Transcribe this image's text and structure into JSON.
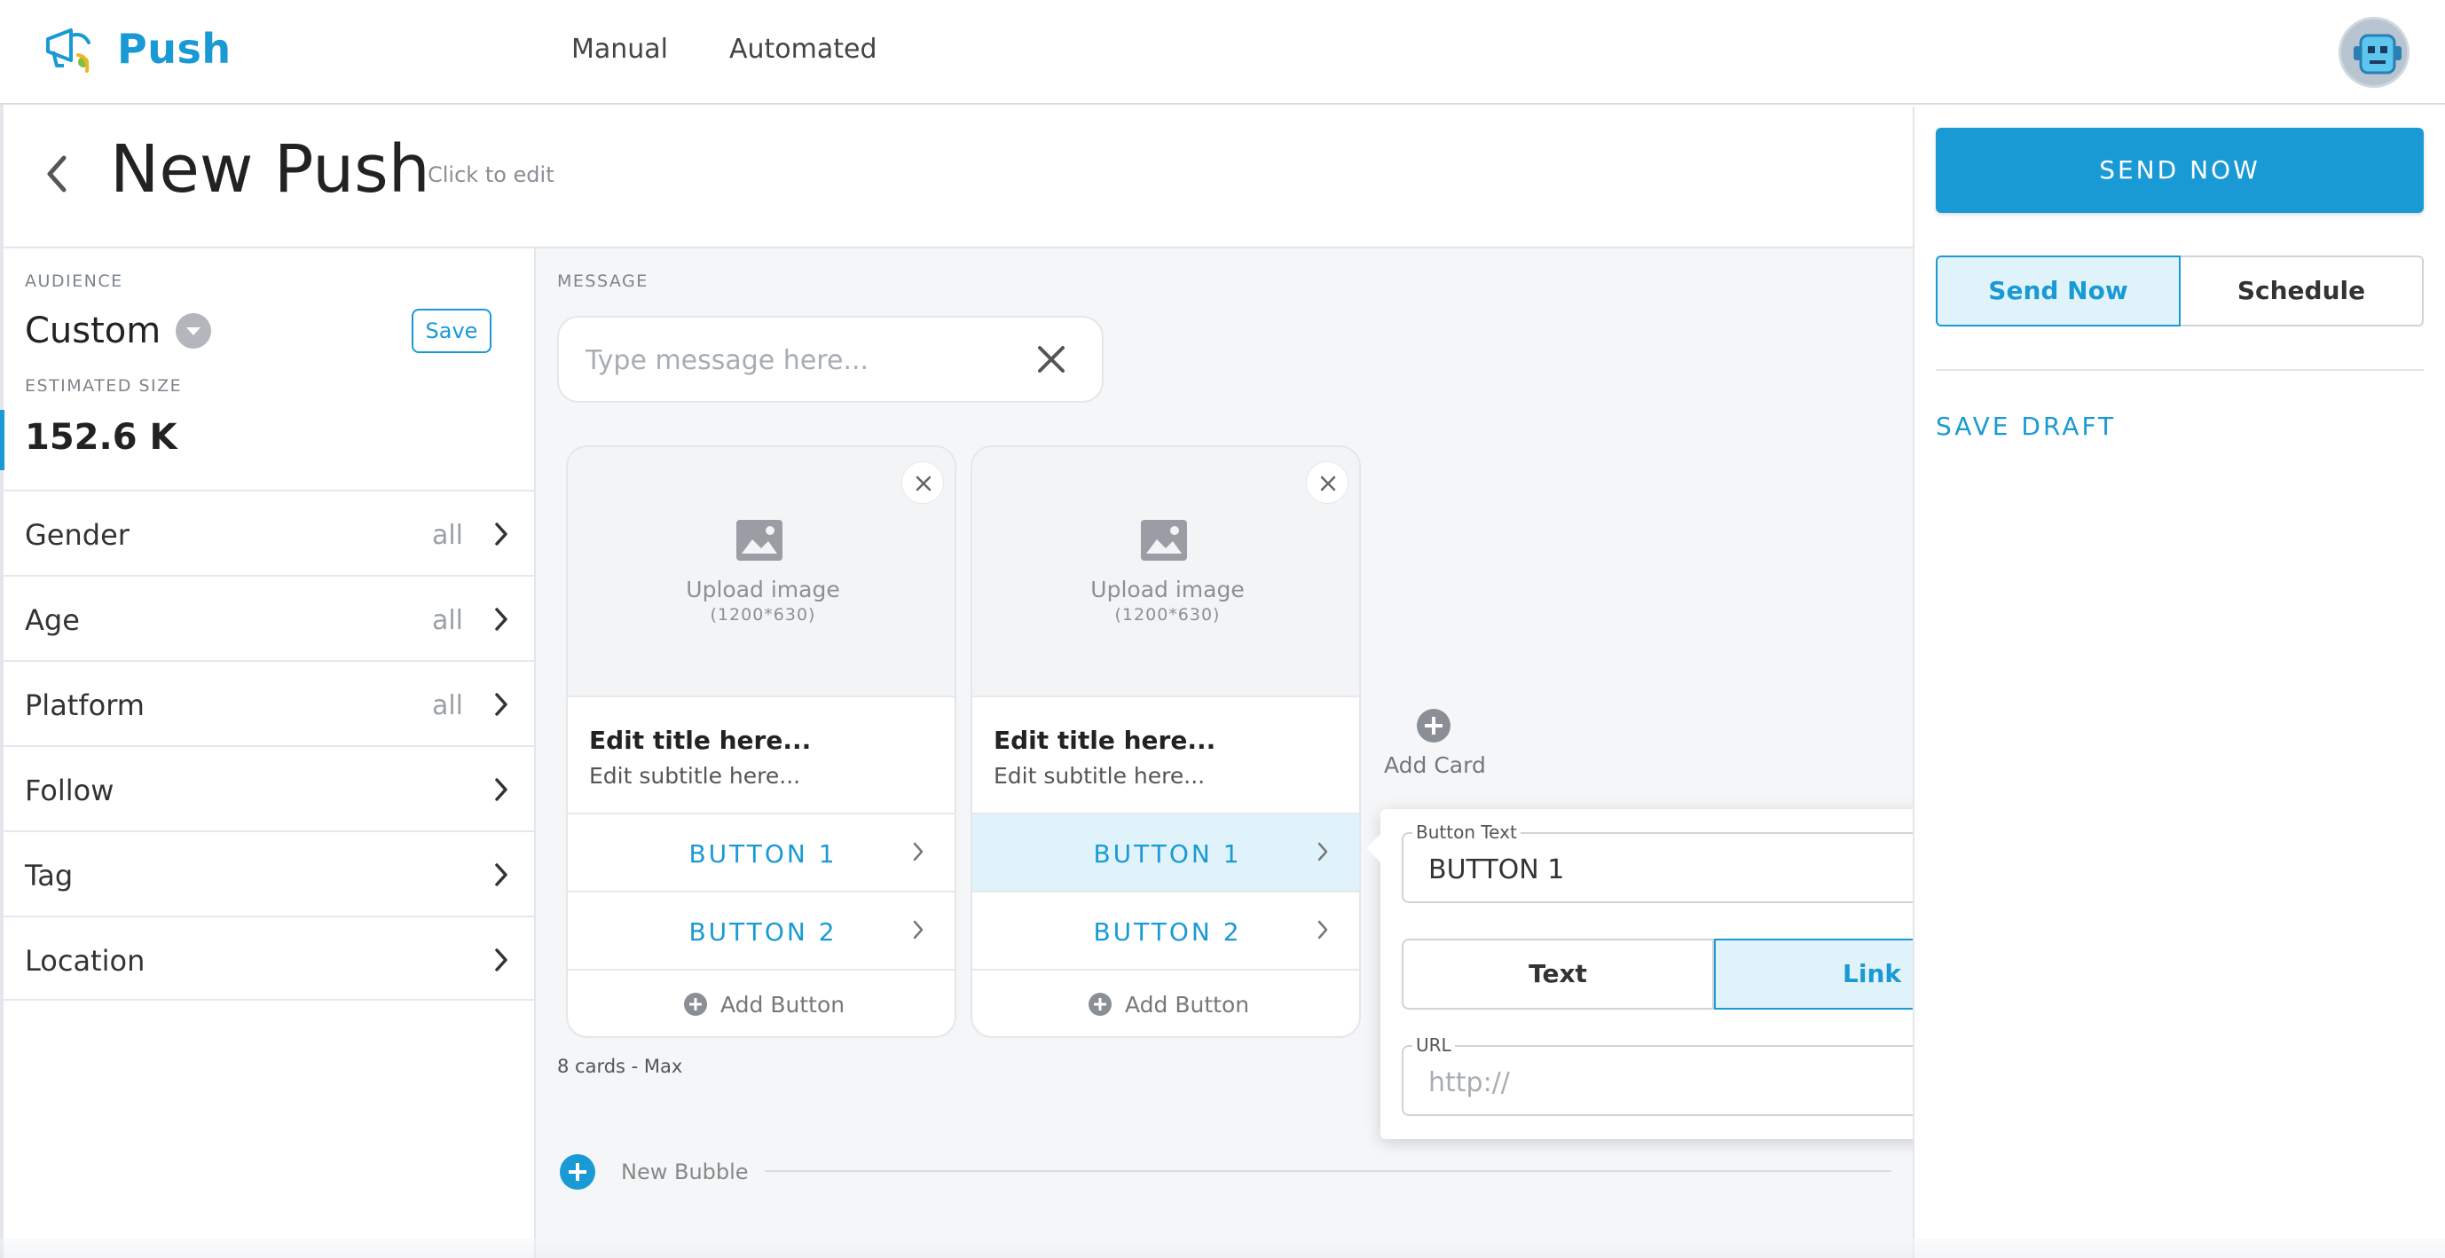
{
  "app": {
    "name": "Push",
    "nav": [
      "Manual",
      "Automated"
    ]
  },
  "header": {
    "title": "New Push",
    "edit_hint": "Click to edit"
  },
  "audience": {
    "label": "AUDIENCE",
    "value": "Custom",
    "save_label": "Save",
    "estimated_label": "ESTIMATED SIZE",
    "estimated_value": "152.6 K",
    "filters": [
      {
        "label": "Gender",
        "value": "all"
      },
      {
        "label": "Age",
        "value": "all"
      },
      {
        "label": "Platform",
        "value": "all"
      },
      {
        "label": "Follow",
        "value": ""
      },
      {
        "label": "Tag",
        "value": ""
      },
      {
        "label": "Location",
        "value": ""
      }
    ]
  },
  "message": {
    "label": "MESSAGE",
    "placeholder": "Type message here...",
    "value": "",
    "cards": [
      {
        "upload_text": "Upload image",
        "upload_size": "(1200*630)",
        "title": "Edit title here...",
        "subtitle": "Edit subtitle here...",
        "buttons": [
          "BUTTON 1",
          "BUTTON 2"
        ],
        "add_button_label": "Add Button"
      },
      {
        "upload_text": "Upload image",
        "upload_size": "(1200*630)",
        "title": "Edit title here...",
        "subtitle": "Edit subtitle here...",
        "buttons": [
          "BUTTON 1",
          "BUTTON 2"
        ],
        "add_button_label": "Add Button",
        "selected_button": 0
      }
    ],
    "add_card_label": "Add Card",
    "cards_max": "8 cards - Max",
    "new_bubble_label": "New Bubble"
  },
  "button_editor": {
    "text_label": "Button Text",
    "text_value": "BUTTON 1",
    "type_options": [
      "Text",
      "Link"
    ],
    "selected_type": "Link",
    "url_label": "URL",
    "url_placeholder": "http://",
    "url_value": ""
  },
  "actions": {
    "send_now_label": "SEND NOW",
    "modes": [
      "Send Now",
      "Schedule"
    ],
    "selected_mode": "Send Now",
    "save_draft_label": "SAVE DRAFT"
  },
  "colors": {
    "accent": "#1a9ad4",
    "selected_bg": "#e1f3fa",
    "panel_bg": "#f4f6f8"
  },
  "icons": {
    "logo": "megaphone-icon",
    "back": "chevron-left-icon",
    "dropdown": "caret-down-icon",
    "filter_chevron": "chevron-right-icon",
    "clear": "close-icon",
    "image": "image-icon",
    "add": "plus-circle-icon",
    "delete": "trash-icon"
  }
}
